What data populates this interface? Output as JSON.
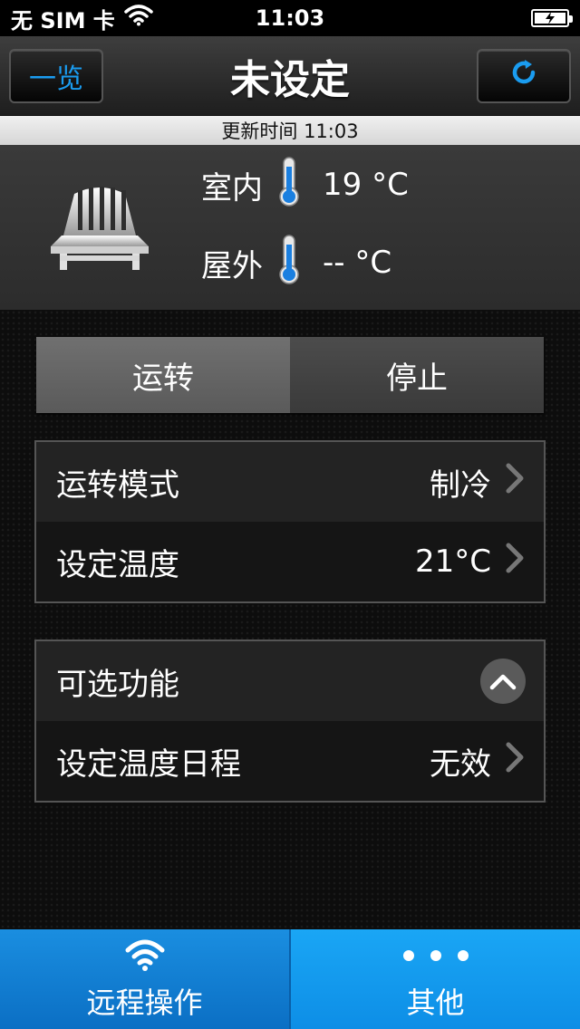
{
  "status_bar": {
    "carrier": "无 SIM 卡",
    "time": "11:03"
  },
  "nav": {
    "left_button": "一览",
    "title": "未设定",
    "right_button_icon": "refresh-icon"
  },
  "update": {
    "text": "更新时间 11:03"
  },
  "temperatures": {
    "indoor_label": "室内",
    "indoor_value": "19 °C",
    "outdoor_label": "屋外",
    "outdoor_value": "-- °C"
  },
  "power": {
    "run_label": "运转",
    "stop_label": "停止",
    "selected": "运转"
  },
  "settings": {
    "mode_label": "运转模式",
    "mode_value": "制冷",
    "temp_label": "设定温度",
    "temp_value": "21°C"
  },
  "options": {
    "title": "可选功能",
    "schedule_label": "设定温度日程",
    "schedule_value": "无效"
  },
  "tabs": {
    "remote_label": "远程操作",
    "other_label": "其他"
  },
  "colors": {
    "accent": "#1a9cf0",
    "tab_active": "#1a8ee0",
    "tab_inactive": "#1aa6f5"
  }
}
